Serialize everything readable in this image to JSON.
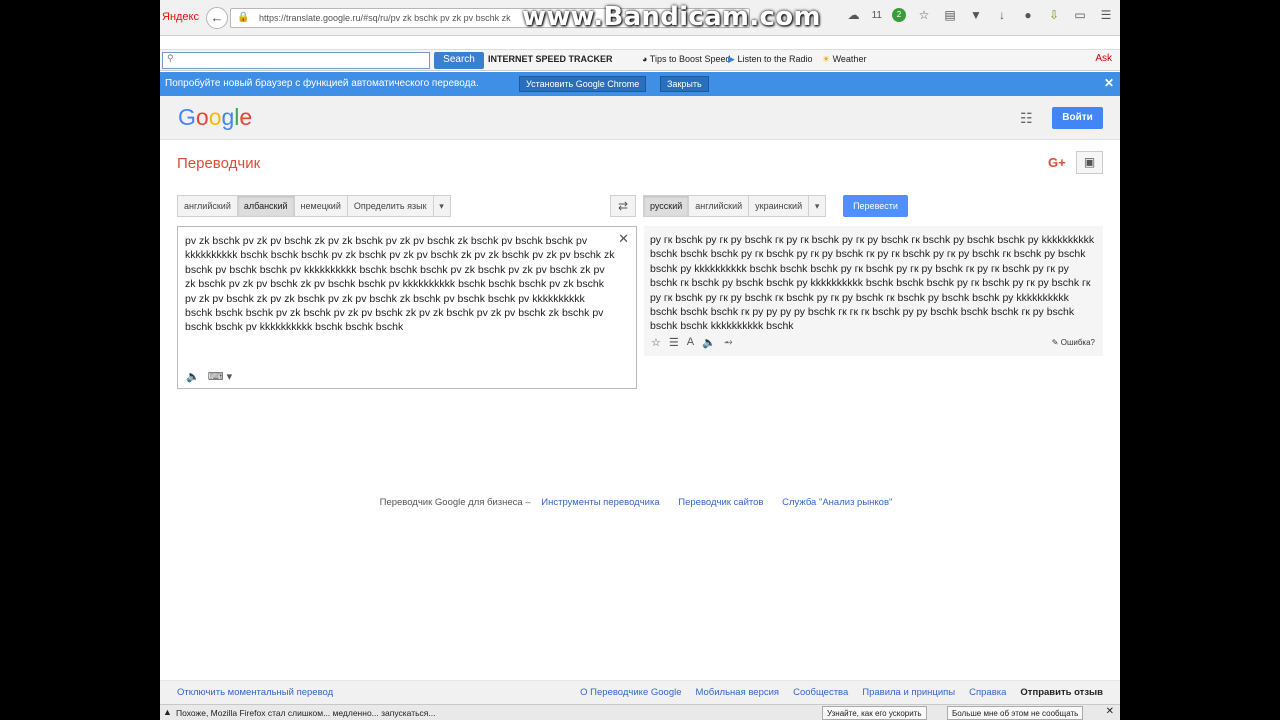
{
  "browser": {
    "brand": "Яндекс",
    "url": "https://translate.google.ru/#sq/ru/pv zk bschk pv zk pv bschk zk",
    "watermark": "www.Bandicam.com",
    "cloud_count": "11",
    "badge_count": "2"
  },
  "toolbar": {
    "search_placeholder": "",
    "search_button": "Search",
    "items": [
      "INTERNET SPEED TRACKER",
      "Tips to Boost Speed",
      "Listen to the Radio",
      "Weather"
    ],
    "ask_label": "Ask"
  },
  "infobar": {
    "text": "Попробуйте новый браузер с функцией автоматического перевода.",
    "install_button": "Установить Google Chrome",
    "close_button": "Закрыть"
  },
  "google": {
    "logo": [
      "G",
      "o",
      "o",
      "g",
      "l",
      "e"
    ],
    "signin": "Войти",
    "title": "Переводчик",
    "gplus": "G+"
  },
  "source_langs": [
    "английский",
    "албанский",
    "немецкий",
    "Определить язык"
  ],
  "source_selected": "албанский",
  "target_langs": [
    "русский",
    "английский",
    "украинский"
  ],
  "target_selected": "русский",
  "translate_button": "Перевести",
  "source_text": "pv zk bschk pv zk pv bschk zk pv zk bschk pv zk pv bschk zk bschk pv bschk bschk pv kkkkkkkkkk bschk bschk bschk pv zk bschk pv zk pv bschk zk pv zk bschk pv zk pv bschk zk bschk pv bschk bschk pv kkkkkkkkkk bschk bschk bschk pv zk bschk pv zk pv bschk zk pv zk bschk pv zk pv bschk zk pv bschk bschk pv kkkkkkkkkk bschk bschk bschk pv zk bschk pv zk pv bschk zk pv zk bschk pv zk pv bschk zk bschk pv bschk bschk pv kkkkkkkkkk bschk bschk bschk pv zk bschk pv zk pv bschk zk pv zk bschk pv zk pv bschk zk bschk pv bschk bschk pv kkkkkkkkkk bschk bschk bschk",
  "result_text": "ру гк bschk ру гк ру bschk гк ру гк bschk ру гк ру bschk гк bschk ру bschk bschk ру kkkkkkkkkk bschk bschk bschk ру гк bschk ру гк ру bschk гк ру гк bschk ру гк ру bschk гк bschk ру bschk bschk ру kkkkkkkkkk bschk bschk bschk ру гк bschk ру гк ру bschk гк ру гк bschk ру гк ру bschk гк bschk ру bschk bschk ру kkkkkkkkkk bschk bschk bschk ру гк bschk ру гк ру bschk гк ру гк bschk ру гк ру bschk гк bschk ру гк ру bschk гк bschk ру bschk bschk ру kkkkkkkkkk bschk bschk bschk гк ру ру ру ру bschk гк гк гк bschk ру ру bschk bschk bschk гк ру bschk bschk bschk kkkkkkkkkk bschk",
  "error_label": "Ошибка?",
  "business": {
    "prefix": "Переводчик Google для бизнеса –",
    "links": [
      "Инструменты переводчика",
      "Переводчик сайтов",
      "Служба \"Анализ рынков\""
    ]
  },
  "footer": {
    "left": "Отключить моментальный перевод",
    "links": [
      "О Переводчике Google",
      "Мобильная версия",
      "Сообщества",
      "Правила и принципы",
      "Справка"
    ],
    "feedback": "Отправить отзыв"
  },
  "statusbar": {
    "message": "Похоже, Mozilla Firefox стал слишком... медленно... запускаться...",
    "button1": "Узнайте, как его ускорить",
    "button2": "Больше мне об этом не сообщать"
  }
}
